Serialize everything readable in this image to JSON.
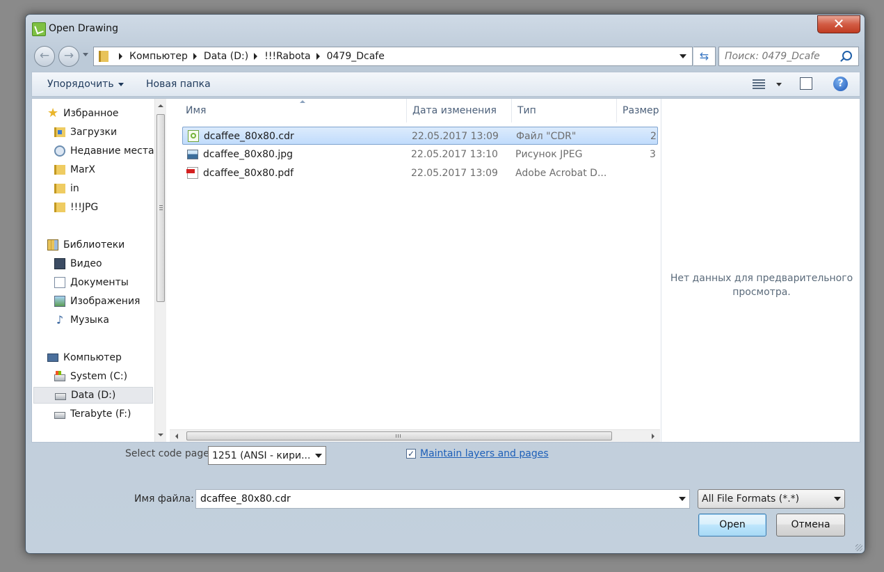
{
  "window": {
    "title": "Open Drawing",
    "close_label": "✕"
  },
  "nav": {
    "breadcrumb": [
      "Компьютер",
      "Data (D:)",
      "!!!Rabota",
      "0479_Dcafe"
    ],
    "search_placeholder": "Поиск: 0479_Dcafe"
  },
  "toolbar": {
    "organize_label": "Упорядочить",
    "new_folder_label": "Новая папка",
    "help_label": "?"
  },
  "sidebar": {
    "favorites_header": "Избранное",
    "favorites": [
      "Загрузки",
      "Недавние места",
      "MarX",
      "in",
      "!!!JPG"
    ],
    "libraries_header": "Библиотеки",
    "libraries": [
      "Видео",
      "Документы",
      "Изображения",
      "Музыка"
    ],
    "computer_header": "Компьютер",
    "drives": [
      "System (C:)",
      "Data (D:)",
      "Terabyte (F:)"
    ],
    "selected": "Data (D:)"
  },
  "files": {
    "columns": [
      "Имя",
      "Дата изменения",
      "Тип",
      "Размер"
    ],
    "rows": [
      {
        "name": "dcaffee_80x80.cdr",
        "date": "22.05.2017 13:09",
        "type": "Файл \"CDR\"",
        "size": "2",
        "icon": "cdr-file-icon",
        "selected": true
      },
      {
        "name": "dcaffee_80x80.jpg",
        "date": "22.05.2017 13:10",
        "type": "Рисунок JPEG",
        "size": "3",
        "icon": "jpeg-file-icon",
        "selected": false
      },
      {
        "name": "dcaffee_80x80.pdf",
        "date": "22.05.2017 13:09",
        "type": "Adobe Acrobat D...",
        "size": "",
        "icon": "pdf-file-icon",
        "selected": false
      }
    ]
  },
  "preview": {
    "empty_text": "Нет данных для предварительного просмотра."
  },
  "options": {
    "code_page_label": "Select code page",
    "code_page_value": "1251  (ANSI - кири...",
    "maintain_layers_label": "Maintain layers and pages",
    "maintain_layers_checked": true
  },
  "footer": {
    "filename_label": "Имя файла:",
    "filename_value": "dcaffee_80x80.cdr",
    "filter_value": "All File Formats (*.*)",
    "open_label": "Open",
    "cancel_label": "Отмена"
  },
  "colors": {
    "link": "#1d5fb8",
    "selection": "#c1dcfc",
    "close": "#c03c22"
  }
}
